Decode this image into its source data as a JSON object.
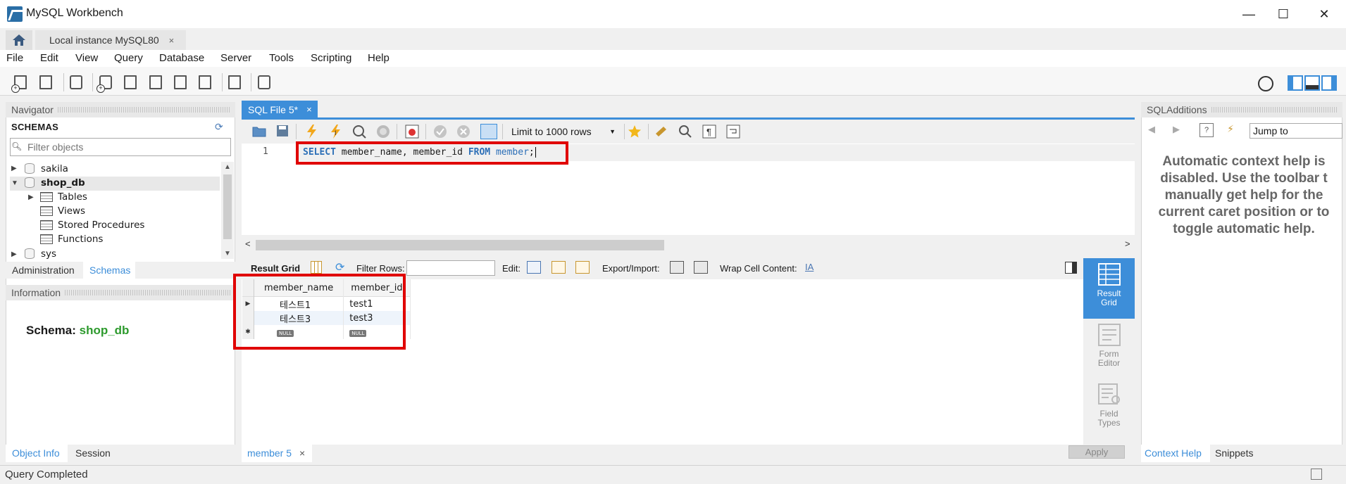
{
  "window": {
    "title": "MySQL Workbench",
    "minimize_glyph": "—",
    "maximize_glyph": "☐",
    "close_glyph": "✕"
  },
  "tabs": {
    "instance_tab_label": "Local instance MySQL80",
    "instance_tab_close": "×"
  },
  "menu": [
    "File",
    "Edit",
    "View",
    "Query",
    "Database",
    "Server",
    "Tools",
    "Scripting",
    "Help"
  ],
  "navigator": {
    "title": "Navigator",
    "schemas_label": "SCHEMAS",
    "filter_placeholder": "Filter objects",
    "tree": {
      "sakila": "sakila",
      "shop_db": "shop_db",
      "tables": "Tables",
      "views": "Views",
      "stored_procedures": "Stored Procedures",
      "functions": "Functions",
      "sys": "sys"
    },
    "bottom_tabs": [
      "Administration",
      "Schemas"
    ]
  },
  "information": {
    "title": "Information",
    "schema_label": "Schema:",
    "schema_value": "shop_db",
    "bottom_tabs": [
      "Object Info",
      "Session"
    ]
  },
  "editor": {
    "tab_label": "SQL File 5*",
    "tab_close": "×",
    "limit_label": "Limit to 1000 rows",
    "line_number": "1",
    "sql": {
      "kw_select": "SELECT",
      "columns": " member_name, member_id ",
      "kw_from": "FROM",
      "table": " member",
      "end": ";"
    }
  },
  "result": {
    "grid_label": "Result Grid",
    "filter_rows_label": "Filter Rows:",
    "edit_label": "Edit:",
    "export_label": "Export/Import:",
    "wrap_label": "Wrap Cell Content:",
    "columns": [
      "member_name",
      "member_id"
    ],
    "rows": [
      [
        "테스트1",
        "test1"
      ],
      [
        "테스트3",
        "test3"
      ]
    ],
    "null_label": "NULL",
    "side_buttons": {
      "result_grid": [
        "Result",
        "Grid"
      ],
      "form_editor": [
        "Form",
        "Editor"
      ],
      "field_types": [
        "Field",
        "Types"
      ]
    },
    "bottom_tab": "member 5",
    "bottom_tab_close": "×",
    "apply_label": "Apply"
  },
  "sql_additions": {
    "title": "SQLAdditions",
    "jump_to": "Jump to",
    "help_text": "Automatic context help is disabled. Use the toolbar t manually get help for the current caret position or to toggle automatic help.",
    "help_lines": [
      "Automatic context help is",
      "disabled. Use the toolbar t",
      "manually get help for the",
      "current caret position or to",
      "toggle automatic help."
    ],
    "bottom_tabs": [
      "Context Help",
      "Snippets"
    ]
  },
  "status": {
    "text": "Query Completed"
  },
  "colors": {
    "accent_blue": "#3d8ed9",
    "highlight_red": "#e00000",
    "schema_green": "#2d9a2d",
    "keyword_blue": "#2c6fb7"
  }
}
